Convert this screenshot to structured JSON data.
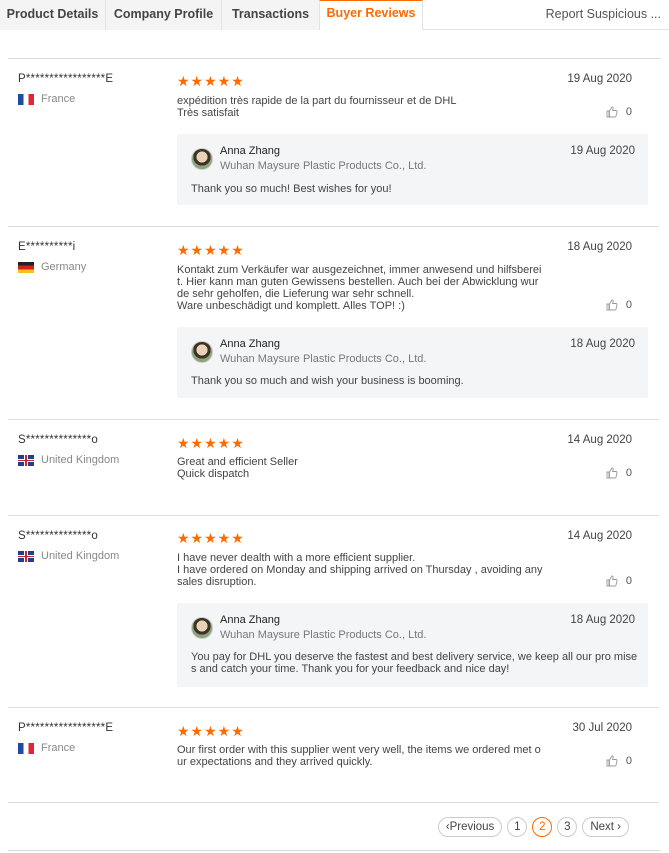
{
  "tabs": [
    {
      "label": "Product Details"
    },
    {
      "label": "Company Profile"
    },
    {
      "label": "Transactions"
    },
    {
      "label": "Buyer Reviews"
    }
  ],
  "report_link": "Report Suspicious ...",
  "stars": "★★★★★",
  "reviews": [
    {
      "buyer": "P*****************E",
      "country": "France",
      "date": "19 Aug 2020",
      "text": "expédition très rapide de la part du fournisseur et de DHL\nTrès satisfait",
      "likes": "0",
      "reply": {
        "name": "Anna Zhang",
        "company": "Wuhan Maysure Plastic Products Co., Ltd.",
        "date": "19 Aug 2020",
        "text": "Thank you so much! Best wishes for you!"
      }
    },
    {
      "buyer": "E**********i",
      "country": "Germany",
      "date": "18 Aug 2020",
      "text": "Kontakt zum Verkäufer war ausgezeichnet, immer anwesend und hilfsberei\nt. Hier kann man guten Gewissens bestellen. Auch bei der Abwicklung wur\nde sehr geholfen, die Lieferung war sehr schnell.\nWare unbeschädigt und komplett. Alles TOP! :)",
      "likes": "0",
      "reply": {
        "name": "Anna Zhang",
        "company": "Wuhan Maysure Plastic Products Co., Ltd.",
        "date": "18 Aug 2020",
        "text": "Thank you so much and wish your business is booming."
      }
    },
    {
      "buyer": "S**************o",
      "country": "United Kingdom",
      "date": "14 Aug 2020",
      "text": "Great and efficient Seller\nQuick dispatch",
      "likes": "0"
    },
    {
      "buyer": "S**************o",
      "country": "United Kingdom",
      "date": "14 Aug 2020",
      "text": "I have never dealth with a more efficient supplier.\nI have ordered on Monday and shipping arrived on Thursday , avoiding any\nsales disruption.",
      "likes": "0",
      "reply": {
        "name": "Anna Zhang",
        "company": "Wuhan Maysure Plastic Products Co., Ltd.",
        "date": "18 Aug 2020",
        "text": "You pay for DHL you deserve the fastest and best delivery service, we keep all our pro mises and catch your time. Thank you for your feedback and nice day!"
      }
    },
    {
      "buyer": "P*****************E",
      "country": "France",
      "date": "30 Jul 2020",
      "text": "Our first order with this supplier went very well, the items we ordered met o\nur expectations and they arrived quickly.",
      "likes": "0"
    }
  ],
  "pagination": {
    "previous": "Previous",
    "next": "Next",
    "pages": [
      "1",
      "2",
      "3"
    ],
    "current": "2"
  },
  "colors": {
    "accent": "#ff6a00"
  }
}
